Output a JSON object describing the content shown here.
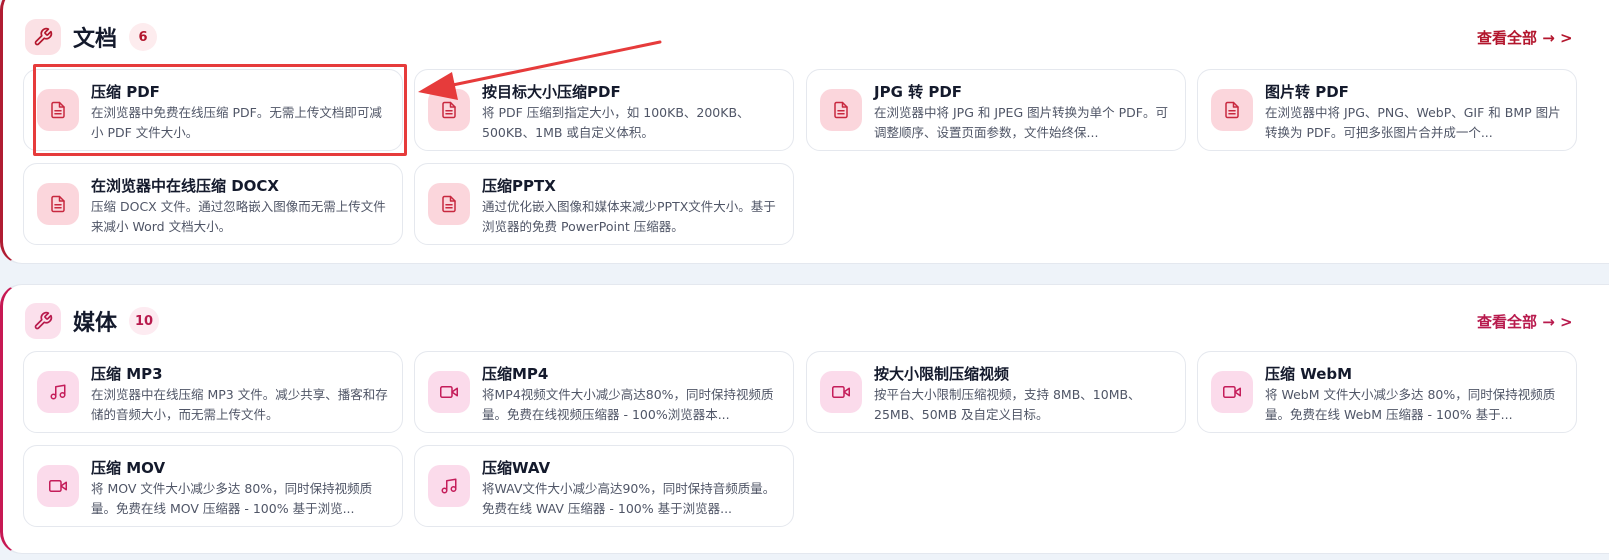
{
  "sections": [
    {
      "title": "文档",
      "count": "6",
      "view_all": "查看全部 → >",
      "cards": [
        {
          "title": "压缩 PDF",
          "desc": "在浏览器中免费在线压缩 PDF。无需上传文档即可减小 PDF 文件大小。",
          "icon": "document-icon"
        },
        {
          "title": "按目标大小压缩PDF",
          "desc": "将 PDF 压缩到指定大小，如 100KB、200KB、500KB、1MB 或自定义体积。",
          "icon": "document-icon"
        },
        {
          "title": "JPG 转 PDF",
          "desc": "在浏览器中将 JPG 和 JPEG 图片转换为单个 PDF。可调整顺序、设置页面参数，文件始终保...",
          "icon": "document-icon"
        },
        {
          "title": "图片转 PDF",
          "desc": "在浏览器中将 JPG、PNG、WebP、GIF 和 BMP 图片转换为 PDF。可把多张图片合并成一个...",
          "icon": "document-icon"
        },
        {
          "title": "在浏览器中在线压缩 DOCX",
          "desc": "压缩 DOCX 文件。通过忽略嵌入图像而无需上传文件来减小 Word 文档大小。",
          "icon": "document-icon"
        },
        {
          "title": "压缩PPTX",
          "desc": "通过优化嵌入图像和媒体来减少PPTX文件大小。基于浏览器的免费 PowerPoint 压缩器。",
          "icon": "document-icon"
        }
      ]
    },
    {
      "title": "媒体",
      "count": "10",
      "view_all": "查看全部 → >",
      "cards": [
        {
          "title": "压缩 MP3",
          "desc": "在浏览器中在线压缩 MP3 文件。减少共享、播客和存储的音频大小，而无需上传文件。",
          "icon": "music-note-icon"
        },
        {
          "title": "压缩MP4",
          "desc": "将MP4视频文件大小减少高达80%，同时保持视频质量。免费在线视频压缩器 - 100%浏览器本...",
          "icon": "video-camera-icon"
        },
        {
          "title": "按大小限制压缩视频",
          "desc": "按平台大小限制压缩视频，支持 8MB、10MB、25MB、50MB 及自定义目标。",
          "icon": "video-camera-icon"
        },
        {
          "title": "压缩 WebM",
          "desc": "将 WebM 文件大小减少多达 80%，同时保持视频质量。免费在线 WebM 压缩器 - 100% 基于...",
          "icon": "video-camera-icon"
        },
        {
          "title": "压缩 MOV",
          "desc": "将 MOV 文件大小减少多达 80%，同时保持视频质量。免费在线 MOV 压缩器 - 100% 基于浏览...",
          "icon": "video-camera-icon"
        },
        {
          "title": "压缩WAV",
          "desc": "将WAV文件大小减少高达90%，同时保持音频质量。免费在线 WAV 压缩器 - 100% 基于浏览器...",
          "icon": "music-note-icon"
        }
      ]
    }
  ],
  "colors": {
    "accent_docs": "#b01c32",
    "accent_media": "#c71853",
    "annotation_red": "#e63b3b"
  }
}
